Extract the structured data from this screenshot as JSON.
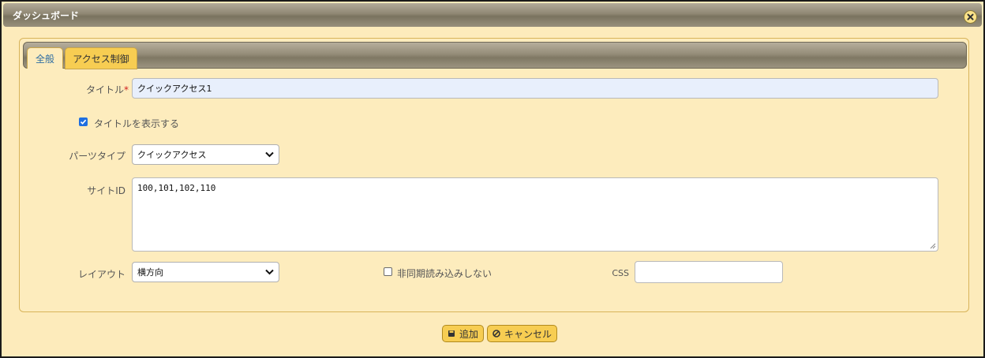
{
  "dialog": {
    "title": "ダッシュボード",
    "close_icon": "close-icon"
  },
  "tabs": [
    {
      "label": "全般",
      "active": true
    },
    {
      "label": "アクセス制御",
      "active": false
    }
  ],
  "form": {
    "title_label": "タイトル",
    "title_required_mark": "*",
    "title_value": "クイックアクセス1",
    "show_title_label": "タイトルを表示する",
    "show_title_checked": true,
    "parts_type_label": "パーツタイプ",
    "parts_type_value": "クイックアクセス",
    "site_id_label": "サイトID",
    "site_id_value": "100,101,102,110",
    "layout_label": "レイアウト",
    "layout_value": "横方向",
    "async_label": "非同期読み込みしない",
    "async_checked": false,
    "css_label": "CSS",
    "css_value": ""
  },
  "footer": {
    "add_label": "追加",
    "cancel_label": "キャンセル"
  },
  "colors": {
    "dialog_bg": "#fdebbb",
    "tab_active_text": "#2d6ca2",
    "button_bg": "#f7cd52",
    "title_input_bg": "#e8effc",
    "required": "#d02020"
  }
}
